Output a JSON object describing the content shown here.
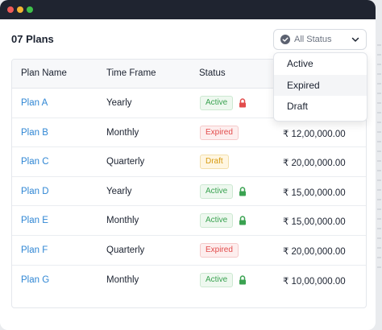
{
  "header": {
    "plans_count": "07 Plans"
  },
  "filter": {
    "label": "All Status",
    "options": [
      "Active",
      "Expired",
      "Draft"
    ]
  },
  "table": {
    "columns": [
      "Plan Name",
      "Time Frame",
      "Status"
    ],
    "rows": [
      {
        "name": "Plan A",
        "timeframe": "Yearly",
        "status": "Active",
        "locked": true,
        "lock_color": "#e24b4b",
        "amount": ""
      },
      {
        "name": "Plan B",
        "timeframe": "Monthly",
        "status": "Expired",
        "locked": false,
        "amount": "₹ 12,00,000.00"
      },
      {
        "name": "Plan C",
        "timeframe": "Quarterly",
        "status": "Draft",
        "locked": false,
        "amount": "₹ 20,00,000.00"
      },
      {
        "name": "Plan D",
        "timeframe": "Yearly",
        "status": "Active",
        "locked": true,
        "lock_color": "#3aa251",
        "amount": "₹ 15,00,000.00"
      },
      {
        "name": "Plan E",
        "timeframe": "Monthly",
        "status": "Active",
        "locked": true,
        "lock_color": "#3aa251",
        "amount": "₹ 15,00,000.00"
      },
      {
        "name": "Plan F",
        "timeframe": "Quarterly",
        "status": "Expired",
        "locked": false,
        "amount": "₹ 20,00,000.00"
      },
      {
        "name": "Plan G",
        "timeframe": "Monthly",
        "status": "Active",
        "locked": true,
        "lock_color": "#3aa251",
        "amount": "₹ 10,00,000.00"
      }
    ]
  },
  "colors": {
    "link": "#2f86d4",
    "active": "#3aa251",
    "expired": "#e24b4b",
    "draft": "#d79a10"
  }
}
